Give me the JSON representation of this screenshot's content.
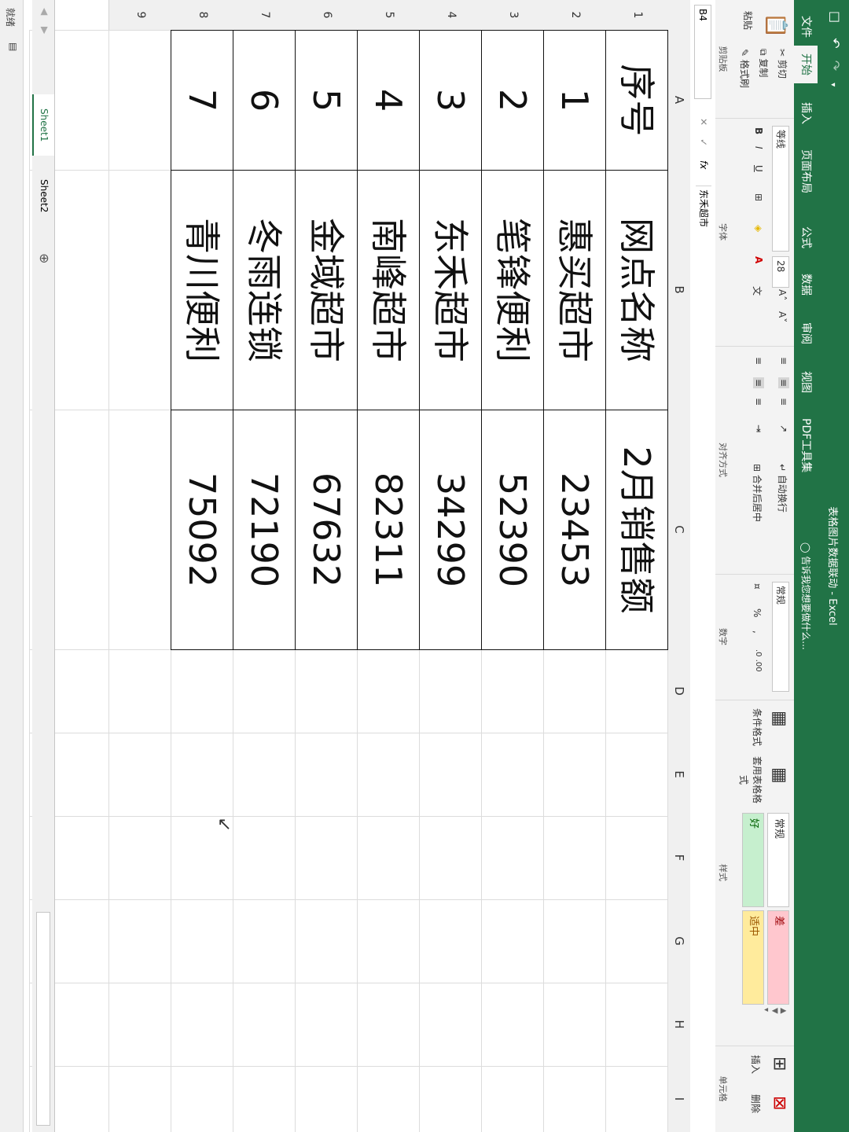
{
  "app": {
    "title": "表格图片数据联动 - Excel",
    "qat": [
      "save-icon",
      "undo-icon",
      "redo-icon",
      "customize-icon"
    ]
  },
  "tabs": [
    "文件",
    "开始",
    "插入",
    "页面布局",
    "公式",
    "数据",
    "审阅",
    "视图",
    "PDF工具集"
  ],
  "active_tab": "开始",
  "tell_me": "告诉我您想要做什么...",
  "ribbon": {
    "clipboard": {
      "paste": "粘贴",
      "cut": "剪切",
      "copy": "复制",
      "format_painter": "格式刷",
      "label": "剪贴板"
    },
    "font": {
      "name": "等线",
      "size": "28",
      "label": "字体",
      "bold": "B",
      "italic": "I",
      "underline": "U"
    },
    "alignment": {
      "wrap": "自动换行",
      "merge": "合并后居中",
      "label": "对齐方式"
    },
    "number": {
      "format": "常规",
      "percent": "%",
      "label": "数字"
    },
    "styles": {
      "conditional": "条件格式",
      "table": "套用表格格式",
      "normal": "常规",
      "bad": "差",
      "good": "好",
      "neutral": "适中",
      "label": "样式"
    },
    "cells": {
      "insert": "插入",
      "delete": "删除",
      "label": "单元格"
    }
  },
  "formula_bar": {
    "name_box": "B4",
    "fx": "fx",
    "value": "东禾超市"
  },
  "columns": [
    "A",
    "B",
    "C",
    "D",
    "E",
    "F",
    "G",
    "H",
    "I"
  ],
  "rows": [
    "1",
    "2",
    "3",
    "4",
    "5",
    "6",
    "7",
    "8",
    "9"
  ],
  "table": {
    "headers": [
      "序号",
      "网点名称",
      "2月销售额"
    ],
    "rows": [
      [
        "1",
        "惠买超市",
        "23453"
      ],
      [
        "2",
        "笔锋便利",
        "52390"
      ],
      [
        "3",
        "东禾超市",
        "34299"
      ],
      [
        "4",
        "南峰超市",
        "82311"
      ],
      [
        "5",
        "金域超市",
        "67632"
      ],
      [
        "6",
        "冬雨连锁",
        "72190"
      ],
      [
        "7",
        "青川便利",
        "75092"
      ]
    ]
  },
  "sheets": [
    "Sheet1",
    "Sheet2"
  ],
  "active_sheet": "Sheet1",
  "status": "就绪",
  "colors": {
    "accent": "#217346",
    "good_bg": "#c6efce",
    "bad_bg": "#ffc7ce",
    "neutral_bg": "#ffeb9c"
  }
}
